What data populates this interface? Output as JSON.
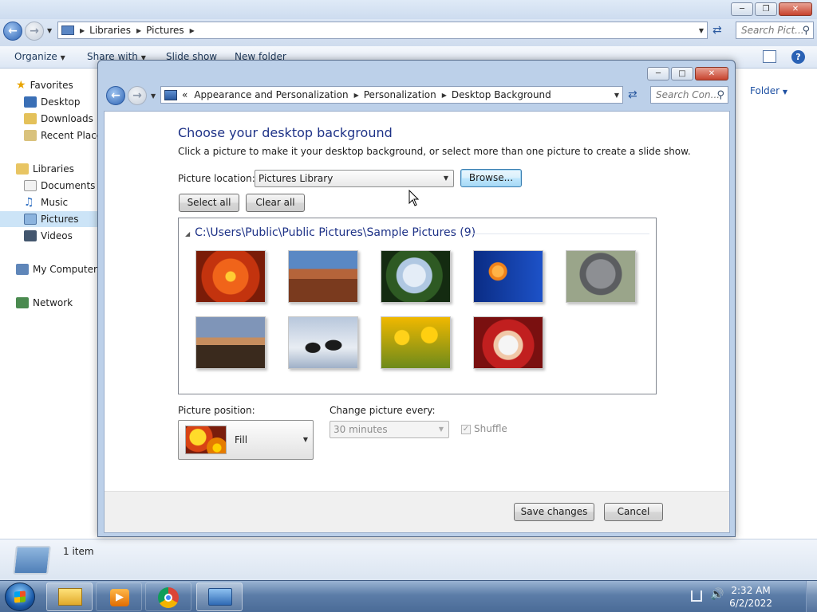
{
  "explorer": {
    "breadcrumb": [
      "Libraries",
      "Pictures"
    ],
    "search_placeholder": "Search Pict...",
    "toolbar": [
      "Organize",
      "Share with",
      "Slide show",
      "New folder"
    ],
    "arrange_label": "Folder",
    "nav": {
      "favorites": "Favorites",
      "desktop": "Desktop",
      "downloads": "Downloads",
      "recent_places": "Recent Places",
      "libraries": "Libraries",
      "documents": "Documents",
      "music": "Music",
      "pictures": "Pictures",
      "videos": "Videos",
      "my_computer": "My Computer",
      "network": "Network"
    },
    "status": "1 item"
  },
  "dialog": {
    "breadcrumb_prefix": "«",
    "breadcrumb": [
      "Appearance and Personalization",
      "Personalization",
      "Desktop Background"
    ],
    "search_placeholder": "Search Con...",
    "heading": "Choose your desktop background",
    "subtext": "Click a picture to make it your desktop background, or select more than one picture to create a slide show.",
    "picture_location_label": "Picture location:",
    "picture_location_value": "Pictures Library",
    "browse_label": "Browse...",
    "select_all_label": "Select all",
    "clear_all_label": "Clear all",
    "group_header": "C:\\Users\\Public\\Public Pictures\\Sample Pictures (9)",
    "picture_position_label": "Picture position:",
    "picture_position_value": "Fill",
    "change_every_label": "Change picture every:",
    "change_every_value": "30 minutes",
    "shuffle_label": "Shuffle",
    "save_label": "Save changes",
    "cancel_label": "Cancel"
  },
  "taskbar": {
    "time": "2:32 AM",
    "date": "6/2/2022"
  }
}
